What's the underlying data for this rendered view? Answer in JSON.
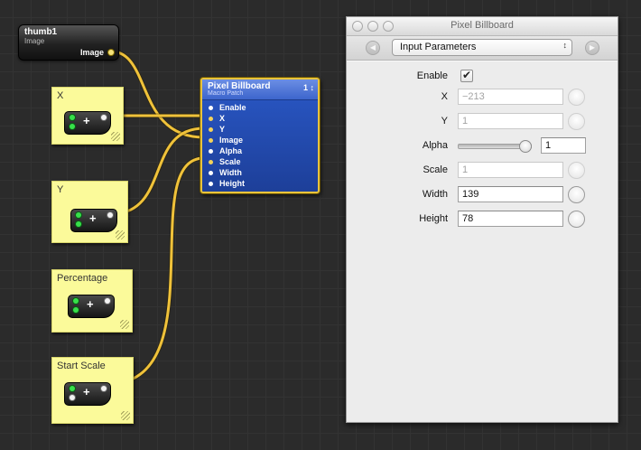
{
  "colors": {
    "wire": "#f0c23a",
    "macro": "#2a58c6",
    "note": "#fbfa9a",
    "canvas": "#2b2b2b"
  },
  "thumb_patch": {
    "title": "thumb1",
    "subtitle": "Image",
    "output_port": "Image"
  },
  "notes": [
    {
      "label": "X"
    },
    {
      "label": "Y"
    },
    {
      "label": "Percentage"
    },
    {
      "label": "Start Scale"
    }
  ],
  "mini_patch": {
    "symbol": "+"
  },
  "macro_patch": {
    "title": "Pixel Billboard",
    "subtitle": "Macro Patch",
    "count": "1 ↕",
    "ports": [
      "Enable",
      "X",
      "Y",
      "Image",
      "Alpha",
      "Scale",
      "Width",
      "Height"
    ]
  },
  "inspector": {
    "window_title": "Pixel Billboard",
    "back_icon": "◀",
    "forward_icon": "▶",
    "popup_value": "Input Parameters",
    "popup_arrows": "↕",
    "params": {
      "enable": {
        "label": "Enable",
        "checked": true,
        "check_glyph": "✔"
      },
      "x": {
        "label": "X",
        "value": "−213"
      },
      "y": {
        "label": "Y",
        "value": "1"
      },
      "alpha": {
        "label": "Alpha",
        "value": "1",
        "slider_fraction": 1.0
      },
      "scale": {
        "label": "Scale",
        "value": "1"
      },
      "width": {
        "label": "Width",
        "value": "139"
      },
      "height": {
        "label": "Height",
        "value": "78"
      }
    }
  }
}
